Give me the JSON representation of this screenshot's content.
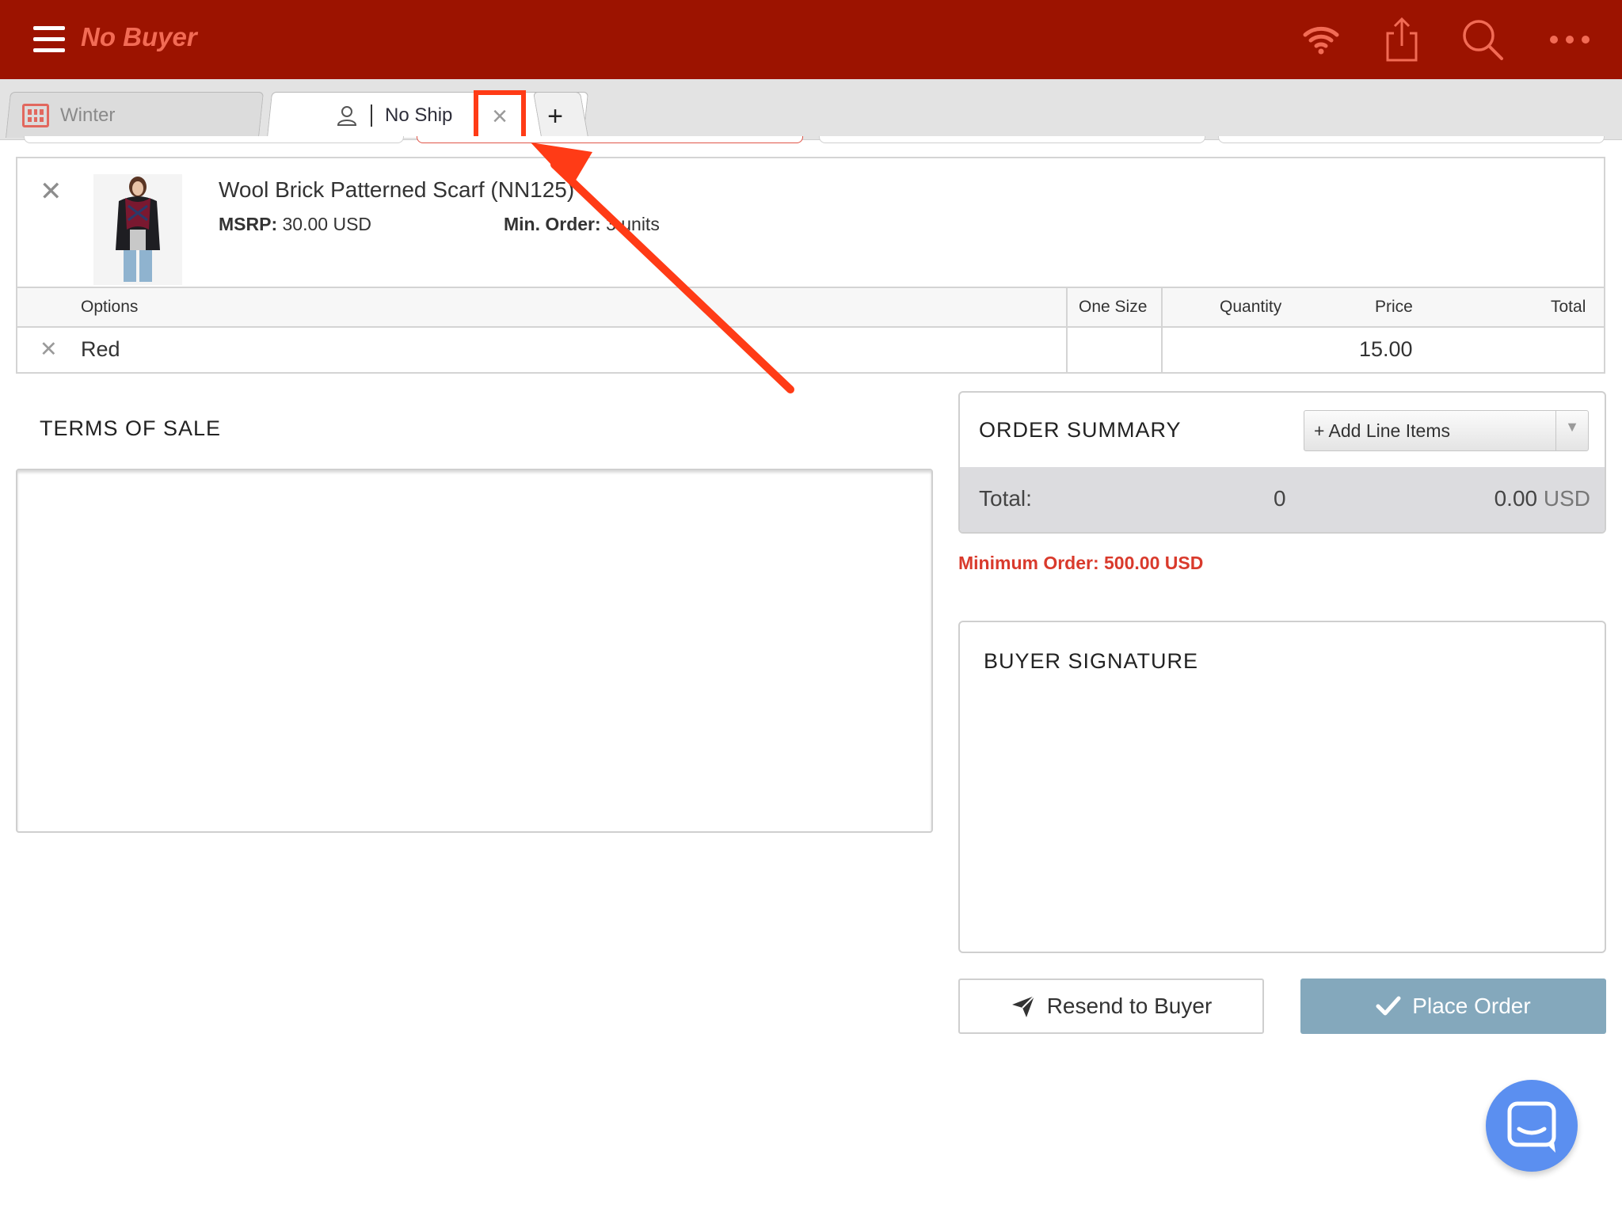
{
  "header": {
    "title": "No Buyer",
    "icons": [
      "menu-icon",
      "wifi-icon",
      "share-icon",
      "search-icon",
      "more-icon"
    ],
    "background": "#9c1300",
    "title_color": "#f26b55"
  },
  "tabs": {
    "items": [
      {
        "label": "Winter",
        "icon": "catalog-grid-icon"
      },
      {
        "label": "No Ship",
        "icon": "user-icon",
        "active": true
      }
    ],
    "close_symbol": "×",
    "add_symbol": "+"
  },
  "product": {
    "name": "Wool Brick Patterned Scarf (NN125)",
    "msrp_label": "MSRP:",
    "msrp_value": "30.00 USD",
    "min_order_label": "Min. Order:",
    "min_order_value": "3 units",
    "remove_symbol": "✕",
    "grid": {
      "headers": [
        "Options",
        "One Size",
        "Quantity",
        "Price",
        "Total"
      ],
      "rows": [
        {
          "remove": "✕",
          "option": "Red",
          "one_size": "",
          "quantity": "",
          "price": "15.00",
          "total": ""
        }
      ]
    }
  },
  "terms": {
    "title": "TERMS OF SALE"
  },
  "summary": {
    "title": "ORDER SUMMARY",
    "add_line_items": "+ Add Line Items",
    "total_label": "Total:",
    "total_quantity": "0",
    "total_amount": "0.00",
    "currency": "USD",
    "minimum_order": "Minimum Order: 500.00 USD"
  },
  "signature": {
    "title": "BUYER SIGNATURE"
  },
  "actions": {
    "resend": "Resend to Buyer",
    "place_order": "Place Order"
  },
  "colors": {
    "accent_red": "#9c1300",
    "min_order_red": "#d93a2c",
    "place_order_bg": "#84a8bc",
    "chat_blue": "#5b8ff0",
    "annotation": "#ff3b16"
  }
}
